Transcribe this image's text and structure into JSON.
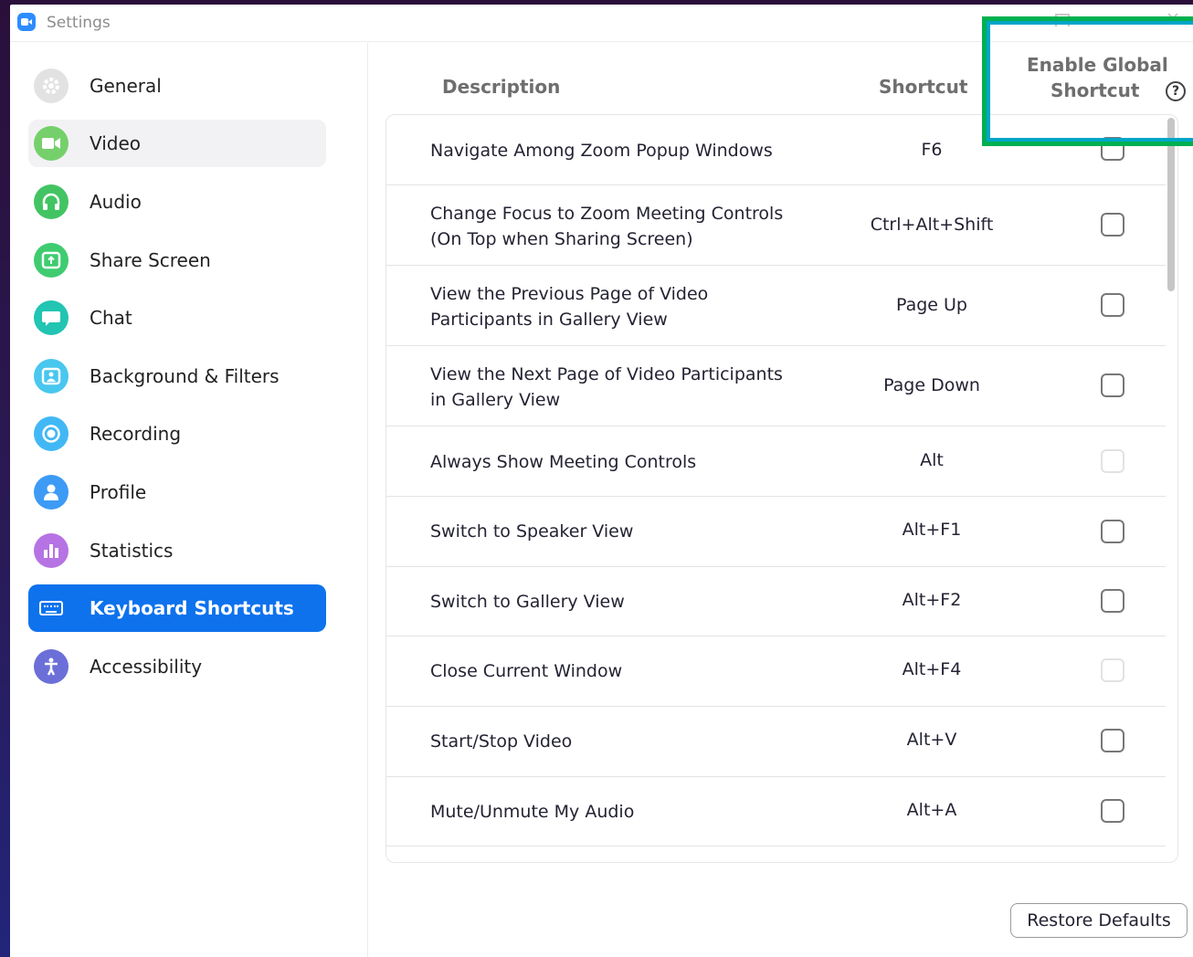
{
  "window": {
    "title": "Settings"
  },
  "sidebar": {
    "items": [
      {
        "label": "General",
        "icon": "gear-icon",
        "color": "#e2e2e2",
        "state": "normal"
      },
      {
        "label": "Video",
        "icon": "video-camera-icon",
        "color": "#75d06b",
        "state": "hover"
      },
      {
        "label": "Audio",
        "icon": "headphones-icon",
        "color": "#43c463",
        "state": "normal"
      },
      {
        "label": "Share Screen",
        "icon": "share-screen-icon",
        "color": "#3fcc70",
        "state": "normal"
      },
      {
        "label": "Chat",
        "icon": "chat-bubble-icon",
        "color": "#22c4b2",
        "state": "normal"
      },
      {
        "label": "Background & Filters",
        "icon": "background-person-icon",
        "color": "#49c7ef",
        "state": "normal"
      },
      {
        "label": "Recording",
        "icon": "record-icon",
        "color": "#41b8f5",
        "state": "normal"
      },
      {
        "label": "Profile",
        "icon": "profile-icon",
        "color": "#3d9bf5",
        "state": "normal"
      },
      {
        "label": "Statistics",
        "icon": "bar-chart-icon",
        "color": "#b673e3",
        "state": "normal"
      },
      {
        "label": "Keyboard Shortcuts",
        "icon": "keyboard-icon",
        "color": "#0e72ed",
        "state": "active"
      },
      {
        "label": "Accessibility",
        "icon": "accessibility-icon",
        "color": "#6c6fd8",
        "state": "normal"
      }
    ]
  },
  "table": {
    "headers": {
      "description": "Description",
      "shortcut": "Shortcut",
      "global_line1": "Enable Global",
      "global_line2": "Shortcut"
    },
    "rows": [
      {
        "description": "Navigate Among Zoom Popup Windows",
        "shortcut": "F6",
        "checkbox": "enabled"
      },
      {
        "description": "Change Focus to Zoom Meeting Controls\n(On Top when Sharing Screen)",
        "shortcut": "Ctrl+Alt+Shift",
        "checkbox": "enabled"
      },
      {
        "description": "View the Previous Page of Video\nParticipants in Gallery View",
        "shortcut": "Page Up",
        "checkbox": "enabled"
      },
      {
        "description": "View the Next Page of Video Participants\nin Gallery View",
        "shortcut": "Page Down",
        "checkbox": "enabled"
      },
      {
        "description": "Always Show Meeting Controls",
        "shortcut": "Alt",
        "checkbox": "disabled"
      },
      {
        "description": "Switch to Speaker View",
        "shortcut": "Alt+F1",
        "checkbox": "enabled"
      },
      {
        "description": "Switch to Gallery View",
        "shortcut": "Alt+F2",
        "checkbox": "enabled"
      },
      {
        "description": "Close Current Window",
        "shortcut": "Alt+F4",
        "checkbox": "disabled"
      },
      {
        "description": "Start/Stop Video",
        "shortcut": "Alt+V",
        "checkbox": "enabled"
      },
      {
        "description": "Mute/Unmute My Audio",
        "shortcut": "Alt+A",
        "checkbox": "enabled"
      }
    ]
  },
  "help_icon": "help-circle-icon",
  "footer": {
    "restore_label": "Restore Defaults"
  },
  "colors": {
    "accent": "#0e72ed",
    "highlight_border": "#00b050"
  }
}
